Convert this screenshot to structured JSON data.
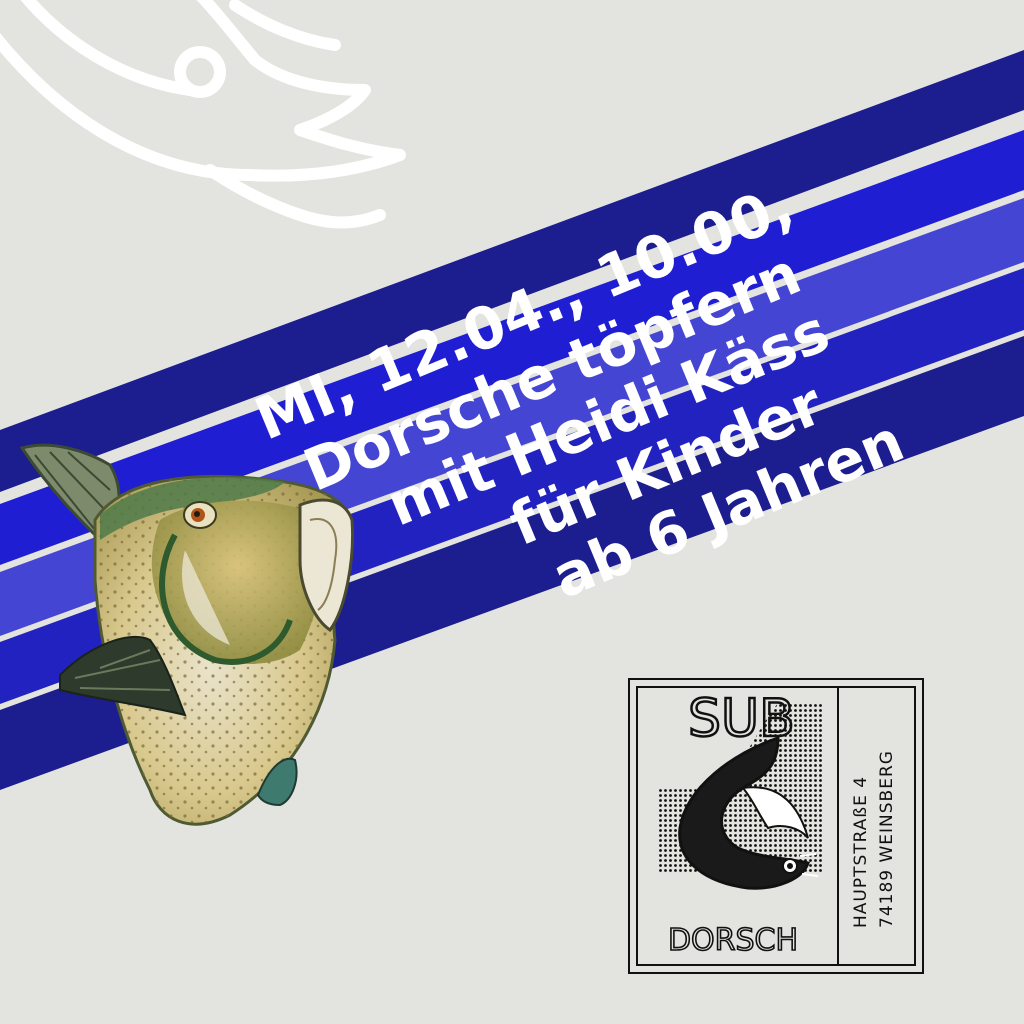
{
  "poster": {
    "lines": [
      "MI, 12.04., 10.00,",
      "Dorsche töpfern",
      "mit Heidi Käss",
      "für Kinder",
      "ab 6 Jahren"
    ]
  },
  "logo": {
    "top_word": "SUB",
    "bottom_word": "DORSCH",
    "address_line1": "HAUPTSTRAßE 4",
    "address_line2": "74189 WEINSBERG"
  },
  "colors": {
    "background": "#e3e3df",
    "band_dark": "#1c1d8e",
    "band_mid": "#1f1ed2",
    "band_light": "#4545d3",
    "band_royal": "#2222c0"
  }
}
